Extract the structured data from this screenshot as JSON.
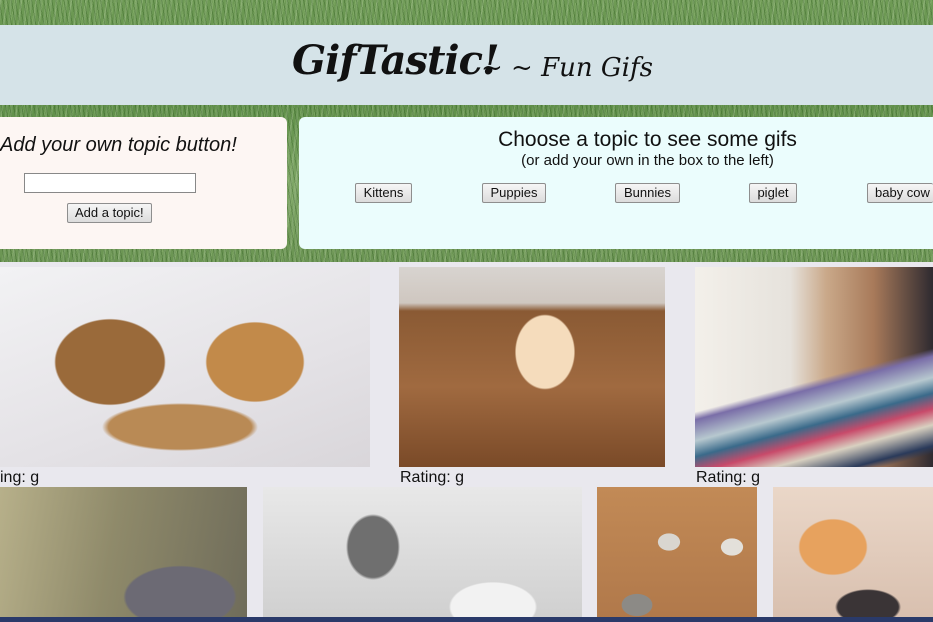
{
  "header": {
    "title": "GifTastic!",
    "subtitle": "~ ~ Fun Gifs"
  },
  "add_panel": {
    "title": "Add your own topic button!",
    "input_value": "",
    "button_label": "Add a topic!"
  },
  "topics": {
    "heading": "Choose a topic to see some gifs",
    "subheading": "(or add your own in the box to the left)",
    "buttons": [
      "Kittens",
      "Puppies",
      "Bunnies",
      "piglet",
      "baby cow"
    ]
  },
  "gifs": {
    "ratings": [
      "ing: g",
      "Rating: g",
      "Rating: g"
    ]
  },
  "colors": {
    "header_bg": "#d5e3e8",
    "add_panel_bg": "#fdf6f3",
    "topic_panel_bg": "#ebfdfd",
    "page_bg": "#e9e8ee"
  }
}
